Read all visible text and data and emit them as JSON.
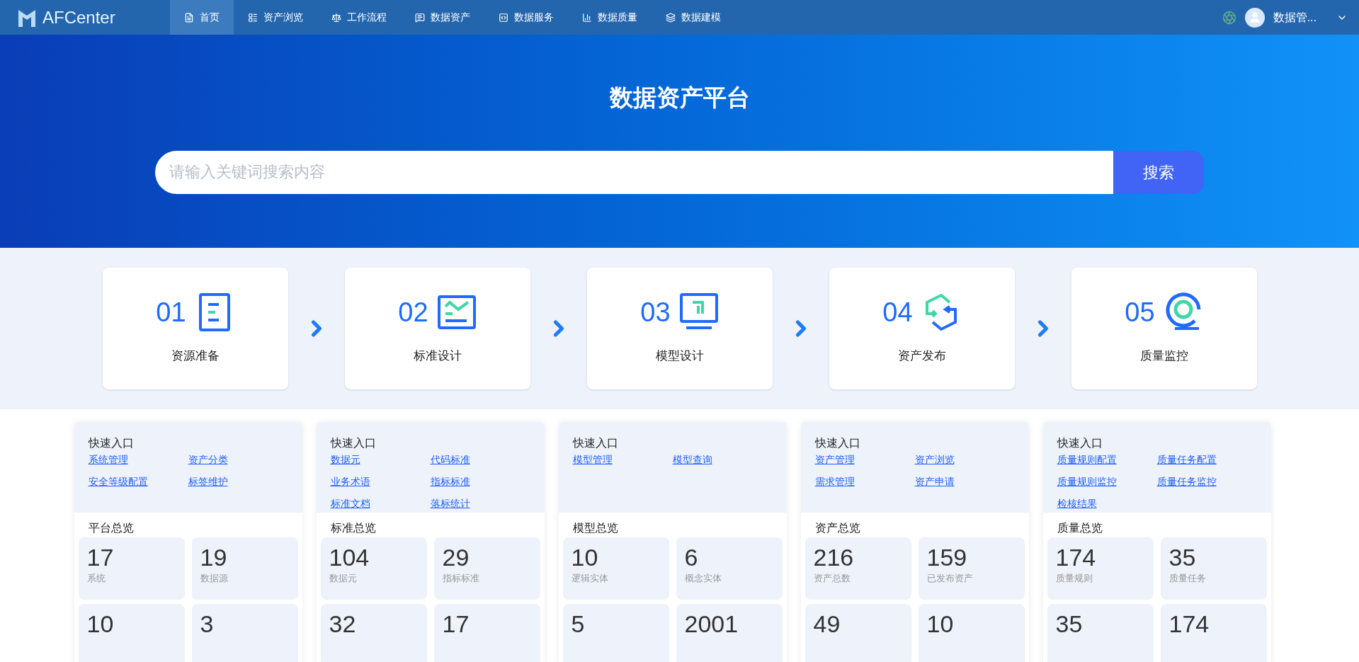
{
  "nav": {
    "logo": "AFCenter",
    "items": [
      {
        "label": "首页",
        "selected": true
      },
      {
        "label": "资产浏览",
        "selected": false
      },
      {
        "label": "工作流程",
        "selected": false
      },
      {
        "label": "数据资产",
        "selected": false
      },
      {
        "label": "数据服务",
        "selected": false
      },
      {
        "label": "数据质量",
        "selected": false
      },
      {
        "label": "数据建模",
        "selected": false
      }
    ],
    "user": "数据管..."
  },
  "hero": {
    "title": "数据资产平台",
    "search": {
      "placeholder": "请输入关键词搜索内容",
      "button": "搜索"
    }
  },
  "steps": [
    {
      "number": "01",
      "label": "资源准备"
    },
    {
      "number": "02",
      "label": "标准设计"
    },
    {
      "number": "03",
      "label": "模型设计"
    },
    {
      "number": "04",
      "label": "资产发布"
    },
    {
      "number": "05",
      "label": "质量监控"
    }
  ],
  "panels": [
    {
      "quick_title": "快速入口",
      "links": [
        "系统管理",
        "资产分类",
        "安全等级配置",
        "标签维护"
      ],
      "overview_title": "平台总览",
      "stats": [
        {
          "value": "17",
          "label": "系统"
        },
        {
          "value": "19",
          "label": "数据源"
        },
        {
          "value": "10"
        },
        {
          "value": "3"
        }
      ]
    },
    {
      "quick_title": "快速入口",
      "links": [
        "数据元",
        "代码标准",
        "业务术语",
        "指标标准",
        "标准文档",
        "落标统计"
      ],
      "overview_title": "标准总览",
      "stats": [
        {
          "value": "104",
          "label": "数据元"
        },
        {
          "value": "29",
          "label": "指标标准"
        },
        {
          "value": "32"
        },
        {
          "value": "17"
        }
      ]
    },
    {
      "quick_title": "快速入口",
      "links": [
        "模型管理",
        "模型查询"
      ],
      "overview_title": "模型总览",
      "stats": [
        {
          "value": "10",
          "label": "逻辑实体"
        },
        {
          "value": "6",
          "label": "概念实体"
        },
        {
          "value": "5"
        },
        {
          "value": "2001"
        }
      ]
    },
    {
      "quick_title": "快速入口",
      "links": [
        "资产管理",
        "资产浏览",
        "需求管理",
        "资产申请"
      ],
      "overview_title": "资产总览",
      "stats": [
        {
          "value": "216",
          "label": "资产总数"
        },
        {
          "value": "159",
          "label": "已发布资产"
        },
        {
          "value": "49"
        },
        {
          "value": "10"
        }
      ]
    },
    {
      "quick_title": "快速入口",
      "links": [
        "质量规则配置",
        "质量任务配置",
        "质量规则监控",
        "质量任务监控",
        "检核结果"
      ],
      "overview_title": "质量总览",
      "stats": [
        {
          "value": "174",
          "label": "质量规则"
        },
        {
          "value": "35",
          "label": "质量任务"
        },
        {
          "value": "35"
        },
        {
          "value": "174"
        }
      ]
    }
  ]
}
